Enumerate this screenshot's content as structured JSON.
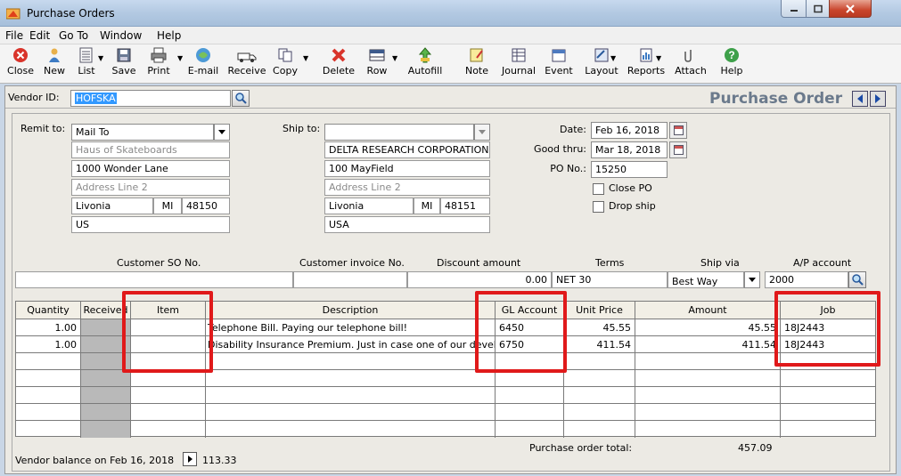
{
  "window": {
    "title": "Purchase Orders"
  },
  "menu": [
    "File",
    "Edit",
    "Go To",
    "Window",
    "Help"
  ],
  "toolbar": [
    {
      "label": "Close",
      "icon": "close-icon"
    },
    {
      "label": "New",
      "icon": "new-icon"
    },
    {
      "label": "List",
      "icon": "list-icon"
    },
    {
      "label": "Save",
      "icon": "save-icon"
    },
    {
      "label": "Print",
      "icon": "print-icon"
    },
    {
      "label": "E-mail",
      "icon": "email-icon"
    },
    {
      "label": "Receive",
      "icon": "receive-icon"
    },
    {
      "label": "Copy",
      "icon": "copy-icon"
    },
    {
      "label": "Delete",
      "icon": "delete-icon"
    },
    {
      "label": "Row",
      "icon": "row-icon"
    },
    {
      "label": "Autofill",
      "icon": "autofill-icon"
    },
    {
      "label": "Note",
      "icon": "note-icon"
    },
    {
      "label": "Journal",
      "icon": "journal-icon"
    },
    {
      "label": "Event",
      "icon": "event-icon"
    },
    {
      "label": "Layout",
      "icon": "layout-icon"
    },
    {
      "label": "Reports",
      "icon": "reports-icon"
    },
    {
      "label": "Attach",
      "icon": "attach-icon"
    },
    {
      "label": "Help",
      "icon": "help-icon"
    }
  ],
  "vendor": {
    "label": "Vendor ID:",
    "value": "HOFSKA"
  },
  "form_title": "Purchase Order",
  "remit_to": {
    "label": "Remit to:",
    "selection": "Mail To",
    "name": "Haus of Skateboards",
    "address1": "1000 Wonder Lane",
    "address2_placeholder": "Address Line 2",
    "city": "Livonia",
    "state": "MI",
    "zip": "48150",
    "country": "US"
  },
  "ship_to": {
    "label": "Ship to:",
    "selection": "",
    "name": "DELTA RESEARCH CORPORATION",
    "address1": "100 MayField",
    "address2_placeholder": "Address Line 2",
    "city": "Livonia",
    "state": "MI",
    "zip": "48151",
    "country": "USA"
  },
  "dates": {
    "date_label": "Date:",
    "date_value": "Feb 16, 2018",
    "good_thru_label": "Good thru:",
    "good_thru_value": "Mar 18, 2018",
    "po_label": "PO No.:",
    "po_value": "15250",
    "close_po_label": "Close PO",
    "drop_ship_label": "Drop ship"
  },
  "info_row": {
    "headers": {
      "customer_so": "Customer SO No.",
      "customer_invoice": "Customer invoice No.",
      "discount": "Discount amount",
      "terms": "Terms",
      "ship_via": "Ship via",
      "ap_account": "A/P account"
    },
    "values": {
      "customer_so": "",
      "customer_invoice": "",
      "discount": "0.00",
      "terms": "NET 30",
      "ship_via": "Best Way",
      "ap_account": "2000"
    }
  },
  "grid": {
    "headers": [
      "Quantity",
      "Received",
      "Item",
      "Description",
      "GL Account",
      "Unit Price",
      "Amount",
      "Job"
    ],
    "rows": [
      {
        "quantity": "1.00",
        "received": "",
        "item": "",
        "description": "Telephone Bill. Paying our telephone bill!",
        "gl_account": "6450",
        "unit_price": "45.55",
        "amount": "45.55",
        "job": "18J2443"
      },
      {
        "quantity": "1.00",
        "received": "",
        "item": "",
        "description": "Disability Insurance Premium. Just in case one of our developers",
        "gl_account": "6750",
        "unit_price": "411.54",
        "amount": "411.54",
        "job": "18J2443"
      }
    ]
  },
  "footer": {
    "vendor_balance_label": "Vendor balance on Feb 16, 2018",
    "vendor_balance_value": "113.33",
    "total_label": "Purchase order total:",
    "total_value": "457.09"
  },
  "colors": {
    "highlight_box": "#e0191a",
    "selection": "#3399ff",
    "title_blue": "#6b7a8c"
  }
}
